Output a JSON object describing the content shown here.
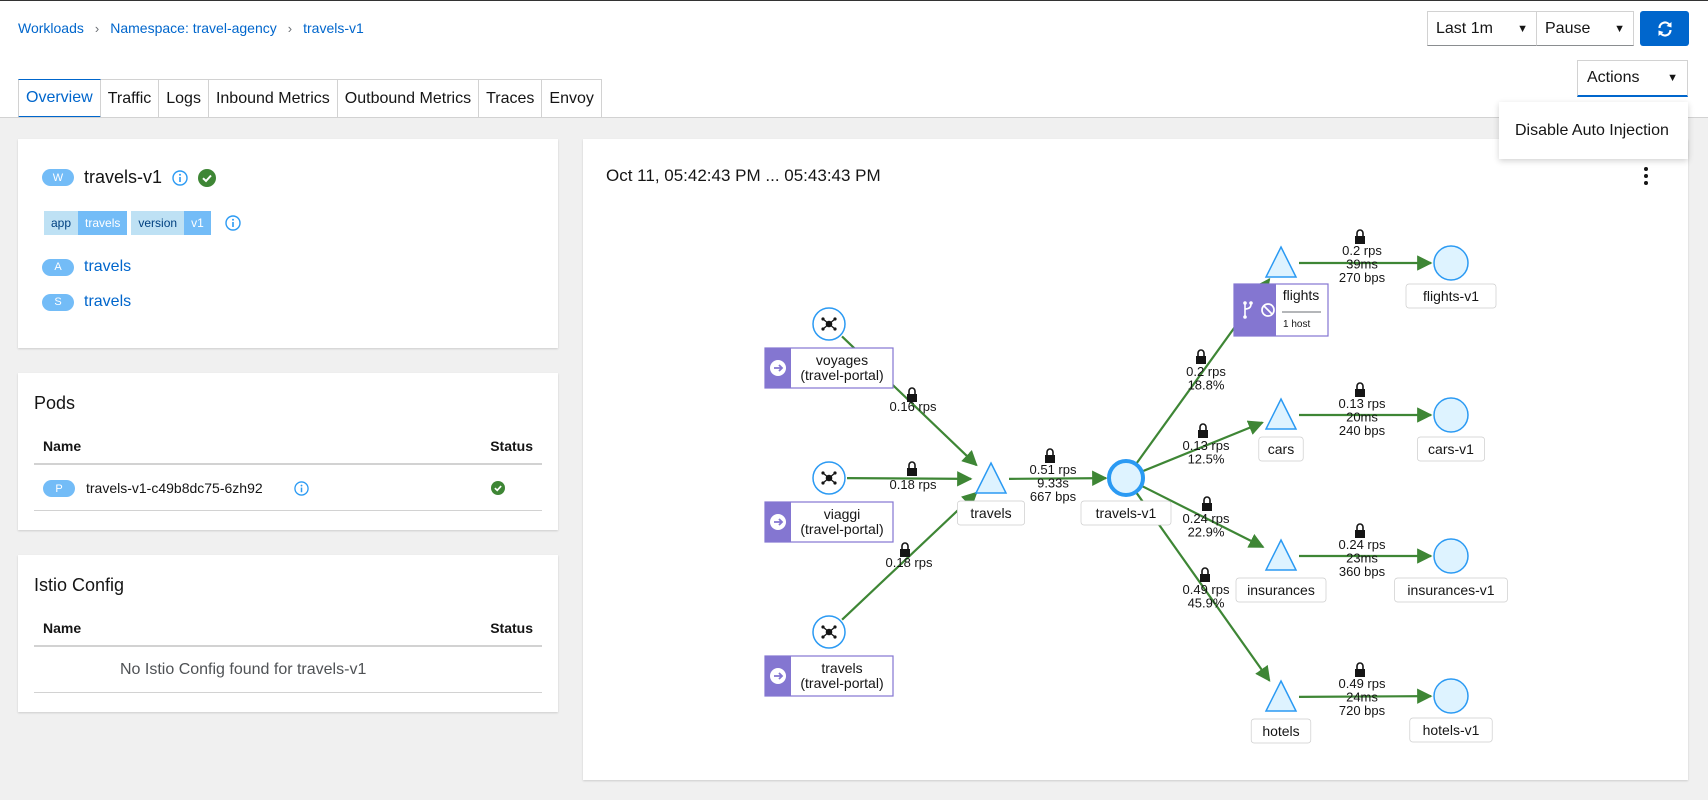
{
  "breadcrumb": {
    "items": [
      "Workloads",
      "Namespace: travel-agency",
      "travels-v1"
    ]
  },
  "toolbar": {
    "interval": "Last 1m",
    "refresh_mode": "Pause"
  },
  "actions": {
    "label": "Actions",
    "menu_items": [
      "Disable Auto Injection"
    ]
  },
  "tabs": [
    "Overview",
    "Traffic",
    "Logs",
    "Inbound Metrics",
    "Outbound Metrics",
    "Traces",
    "Envoy"
  ],
  "active_tab": "Overview",
  "workload": {
    "badge": "W",
    "name": "travels-v1",
    "labels": [
      {
        "key": "app",
        "value": "travels"
      },
      {
        "key": "version",
        "value": "v1"
      }
    ],
    "app": {
      "badge": "A",
      "name": "travels"
    },
    "service": {
      "badge": "S",
      "name": "travels"
    }
  },
  "pods": {
    "title": "Pods",
    "columns": [
      "Name",
      "Status"
    ],
    "rows": [
      {
        "badge": "P",
        "name": "travels-v1-c49b8dc75-6zh92",
        "status": "healthy"
      }
    ]
  },
  "istio_config": {
    "title": "Istio Config",
    "columns": [
      "Name",
      "Status"
    ],
    "empty_text": "No Istio Config found for travels-v1"
  },
  "graph": {
    "title": "Oct 11, 05:42:43 PM ... 05:43:43 PM",
    "nodes": [
      {
        "id": "voyages-tp",
        "label": [
          "voyages",
          "(travel-portal)"
        ],
        "kind": "workload-box"
      },
      {
        "id": "viaggi-tp",
        "label": [
          "viaggi",
          "(travel-portal)"
        ],
        "kind": "workload-box"
      },
      {
        "id": "travels-tp",
        "label": [
          "travels",
          "(travel-portal)"
        ],
        "kind": "workload-box"
      },
      {
        "id": "travels-svc",
        "label": [
          "travels"
        ],
        "kind": "service"
      },
      {
        "id": "travels-v1",
        "label": [
          "travels-v1"
        ],
        "kind": "workload"
      },
      {
        "id": "flights-svc",
        "label": [
          "flights"
        ],
        "sublabel": "1 host",
        "kind": "service-entry"
      },
      {
        "id": "cars-svc",
        "label": [
          "cars"
        ],
        "kind": "service"
      },
      {
        "id": "insurances-svc",
        "label": [
          "insurances"
        ],
        "kind": "service"
      },
      {
        "id": "hotels-svc",
        "label": [
          "hotels"
        ],
        "kind": "service"
      },
      {
        "id": "flights-v1",
        "label": [
          "flights-v1"
        ],
        "kind": "workload"
      },
      {
        "id": "cars-v1",
        "label": [
          "cars-v1"
        ],
        "kind": "workload"
      },
      {
        "id": "insurances-v1",
        "label": [
          "insurances-v1"
        ],
        "kind": "workload"
      },
      {
        "id": "hotels-v1",
        "label": [
          "hotels-v1"
        ],
        "kind": "workload"
      }
    ],
    "edges": [
      {
        "from": "voyages-tp",
        "to": "travels-svc",
        "text": [
          "0.16 rps"
        ]
      },
      {
        "from": "viaggi-tp",
        "to": "travels-svc",
        "text": [
          "0.18 rps"
        ]
      },
      {
        "from": "travels-tp",
        "to": "travels-svc",
        "text": [
          "0.18 rps"
        ]
      },
      {
        "from": "travels-svc",
        "to": "travels-v1",
        "text": [
          "0.51 rps",
          "9.33s",
          "667 bps"
        ]
      },
      {
        "from": "travels-v1",
        "to": "flights-svc",
        "text": [
          "0.2 rps",
          "18.8%"
        ]
      },
      {
        "from": "travels-v1",
        "to": "cars-svc",
        "text": [
          "0.13 rps",
          "12.5%"
        ]
      },
      {
        "from": "travels-v1",
        "to": "insurances-svc",
        "text": [
          "0.24 rps",
          "22.9%"
        ]
      },
      {
        "from": "travels-v1",
        "to": "hotels-svc",
        "text": [
          "0.49 rps",
          "45.9%"
        ]
      },
      {
        "from": "flights-svc",
        "to": "flights-v1",
        "text": [
          "0.2 rps",
          "39ms",
          "270 bps"
        ]
      },
      {
        "from": "cars-svc",
        "to": "cars-v1",
        "text": [
          "0.13 rps",
          "20ms",
          "240 bps"
        ]
      },
      {
        "from": "insurances-svc",
        "to": "insurances-v1",
        "text": [
          "0.24 rps",
          "23ms",
          "360 bps"
        ]
      },
      {
        "from": "hotels-svc",
        "to": "hotels-v1",
        "text": [
          "0.49 rps",
          "24ms",
          "720 bps"
        ]
      }
    ]
  },
  "colors": {
    "accent": "#0066cc",
    "edge": "#3e8635",
    "node_fill": "#def3ff",
    "node_stroke": "#2b9af3",
    "purple": "#8476d1",
    "success": "#3e8635"
  }
}
